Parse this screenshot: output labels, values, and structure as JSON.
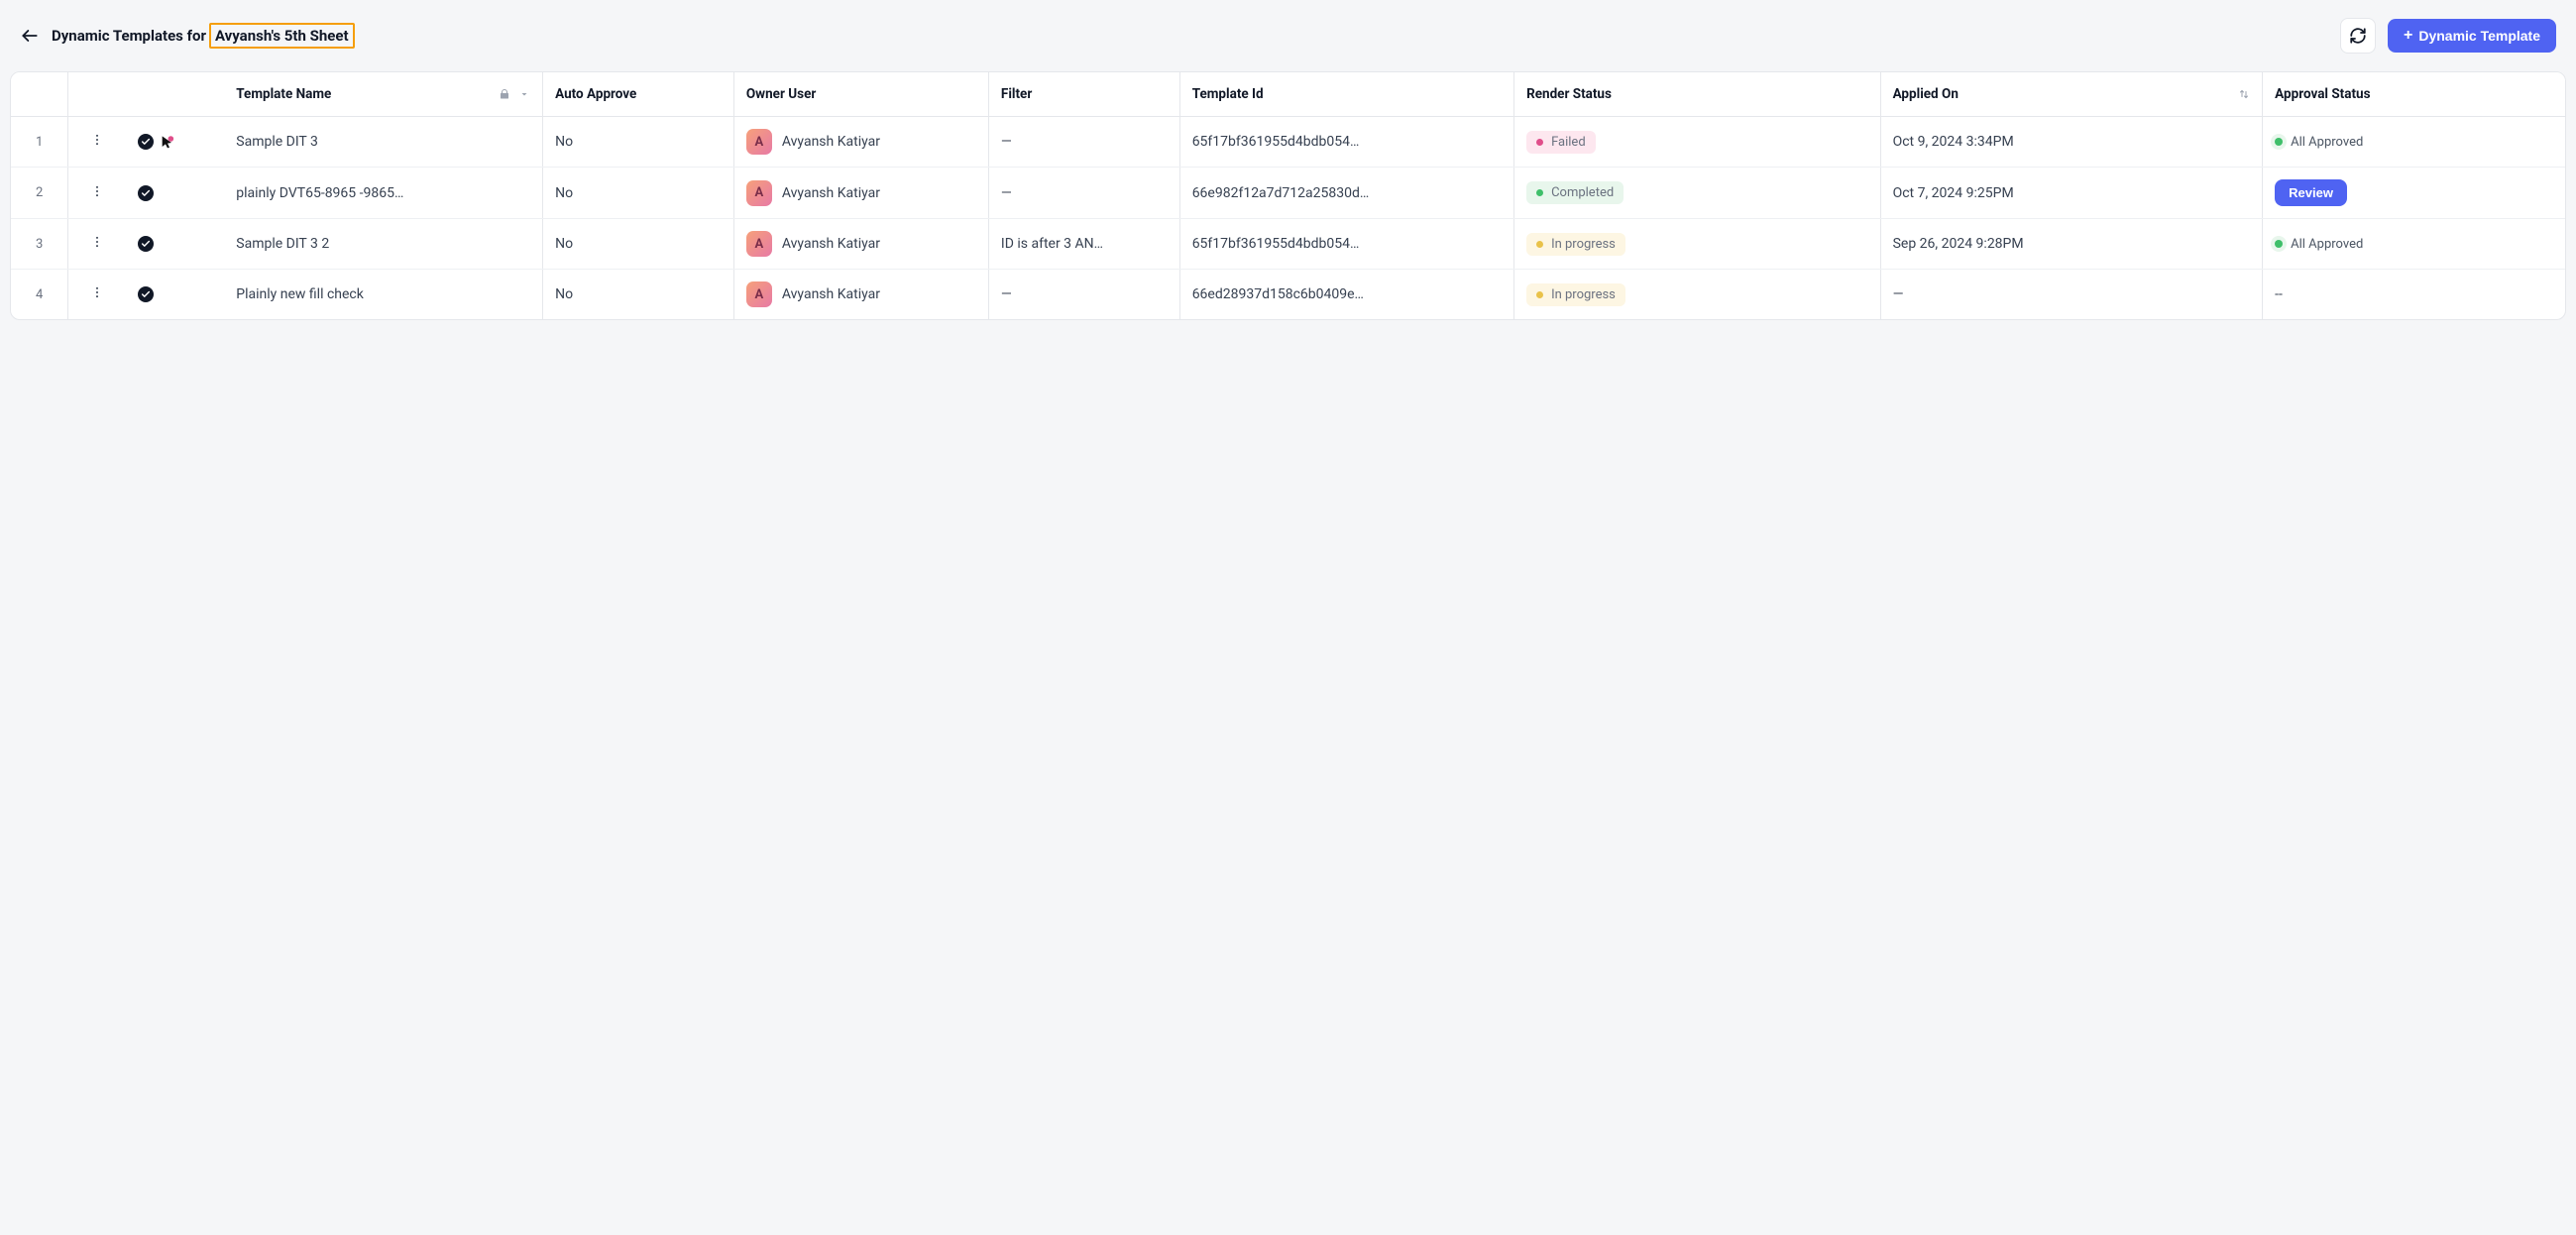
{
  "header": {
    "title_prefix": "Dynamic Templates for",
    "title_highlight": "Avyansh's 5th Sheet",
    "add_button_label": "Dynamic Template"
  },
  "columns": {
    "template_name": "Template Name",
    "auto_approve": "Auto Approve",
    "owner_user": "Owner User",
    "filter": "Filter",
    "template_id": "Template Id",
    "render_status": "Render Status",
    "applied_on": "Applied On",
    "approval_status": "Approval Status"
  },
  "rows": [
    {
      "num": "1",
      "has_cursor_badge": true,
      "name": "Sample DIT 3",
      "auto_approve": "No",
      "owner_initial": "A",
      "owner_name": "Avyansh Katiyar",
      "filter": "—",
      "template_id": "65f17bf361955d4bdb054…",
      "render_status": {
        "label": "Failed",
        "kind": "fail"
      },
      "applied_on": "Oct 9, 2024 3:34PM",
      "approval": {
        "kind": "approved",
        "label": "All Approved"
      }
    },
    {
      "num": "2",
      "has_cursor_badge": false,
      "name": "plainly DVT65-8965 -9865…",
      "auto_approve": "No",
      "owner_initial": "A",
      "owner_name": "Avyansh Katiyar",
      "filter": "—",
      "template_id": "66e982f12a7d712a25830d…",
      "render_status": {
        "label": "Completed",
        "kind": "ok"
      },
      "applied_on": "Oct 7, 2024 9:25PM",
      "approval": {
        "kind": "review",
        "label": "Review"
      }
    },
    {
      "num": "3",
      "has_cursor_badge": false,
      "name": "Sample DIT 3 2",
      "auto_approve": "No",
      "owner_initial": "A",
      "owner_name": "Avyansh Katiyar",
      "filter": "ID is after 3 AN…",
      "template_id": "65f17bf361955d4bdb054…",
      "render_status": {
        "label": "In progress",
        "kind": "warn"
      },
      "applied_on": "Sep 26, 2024 9:28PM",
      "approval": {
        "kind": "approved",
        "label": "All Approved"
      }
    },
    {
      "num": "4",
      "has_cursor_badge": false,
      "name": "Plainly new fill check",
      "auto_approve": "No",
      "owner_initial": "A",
      "owner_name": "Avyansh Katiyar",
      "filter": "—",
      "template_id": "66ed28937d158c6b0409e…",
      "render_status": {
        "label": "In progress",
        "kind": "warn"
      },
      "applied_on": "—",
      "approval": {
        "kind": "none",
        "label": "--"
      }
    }
  ]
}
